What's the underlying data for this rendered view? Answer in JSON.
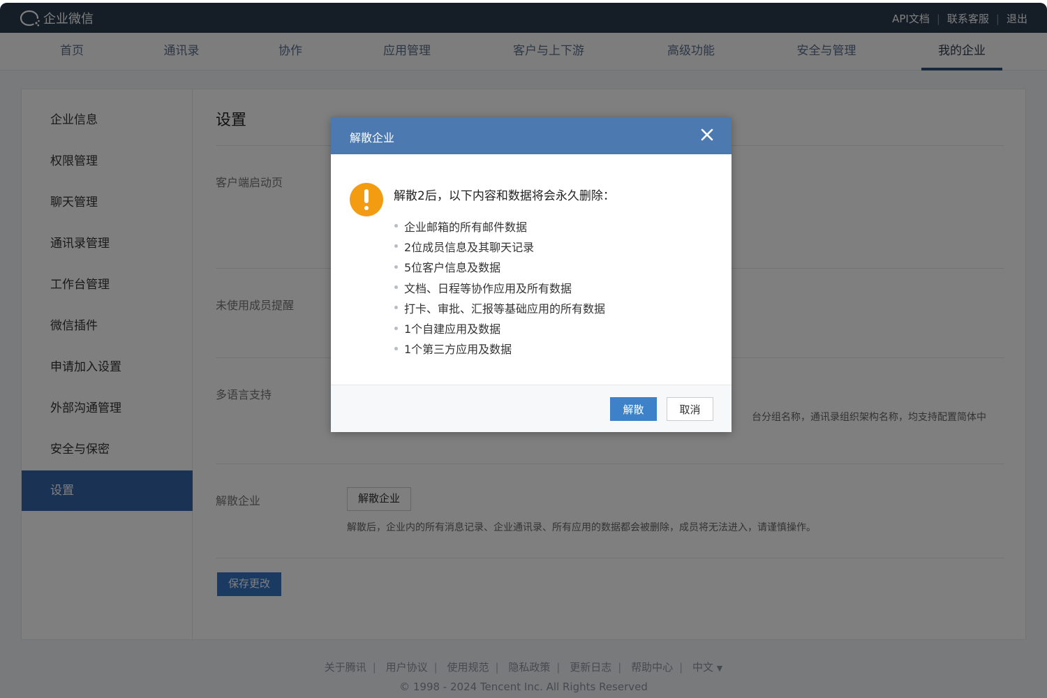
{
  "app": {
    "title": "企业微信"
  },
  "toplinks": {
    "api_docs": "API文档",
    "support": "联系客服",
    "logout": "退出"
  },
  "nav": {
    "items": [
      "首页",
      "通讯录",
      "协作",
      "应用管理",
      "客户与上下游",
      "高级功能",
      "安全与管理",
      "我的企业"
    ],
    "active": "我的企业"
  },
  "sidebar": {
    "items": [
      "企业信息",
      "权限管理",
      "聊天管理",
      "通讯录管理",
      "工作台管理",
      "微信插件",
      "申请加入设置",
      "外部沟通管理",
      "安全与保密",
      "设置"
    ],
    "active": "设置"
  },
  "settings": {
    "title": "设置",
    "rows": {
      "client_startup": "客户端启动页",
      "inactive_reminder": "未使用成员提醒",
      "multilang": "多语言支持",
      "dissolve": "解散企业"
    },
    "multilang_desc_visible": "台分组名称，通讯录组织架构名称，均支持配置简体中",
    "dissolve_button": "解散企业",
    "dissolve_desc": "解散后，企业内的所有消息记录、企业通讯录、所有应用的数据都会被删除，成员将无法进入，请谨慎操作。",
    "save_button": "保存更改"
  },
  "footer": {
    "links": [
      "关于腾讯",
      "用户协议",
      "使用规范",
      "隐私政策",
      "更新日志",
      "帮助中心"
    ],
    "language": "中文",
    "copyright": "© 1998 - 2024 Tencent Inc. All Rights Reserved"
  },
  "modal": {
    "title": "解散企业",
    "heading": "解散2后，以下内容和数据将会永久删除：",
    "items": [
      "企业邮箱的所有邮件数据",
      "2位成员信息及其聊天记录",
      "5位客户信息及数据",
      "文档、日程等协作应用及所有数据",
      "打卡、审批、汇报等基础应用的所有数据",
      "1个自建应用及数据",
      "1个第三方应用及数据"
    ],
    "confirm_button": "解散",
    "cancel_button": "取消"
  },
  "colors": {
    "topbar": "#2b3a4f",
    "modal_header": "#4c79b0",
    "primary": "#3574c4",
    "warning": "#f39c12"
  }
}
